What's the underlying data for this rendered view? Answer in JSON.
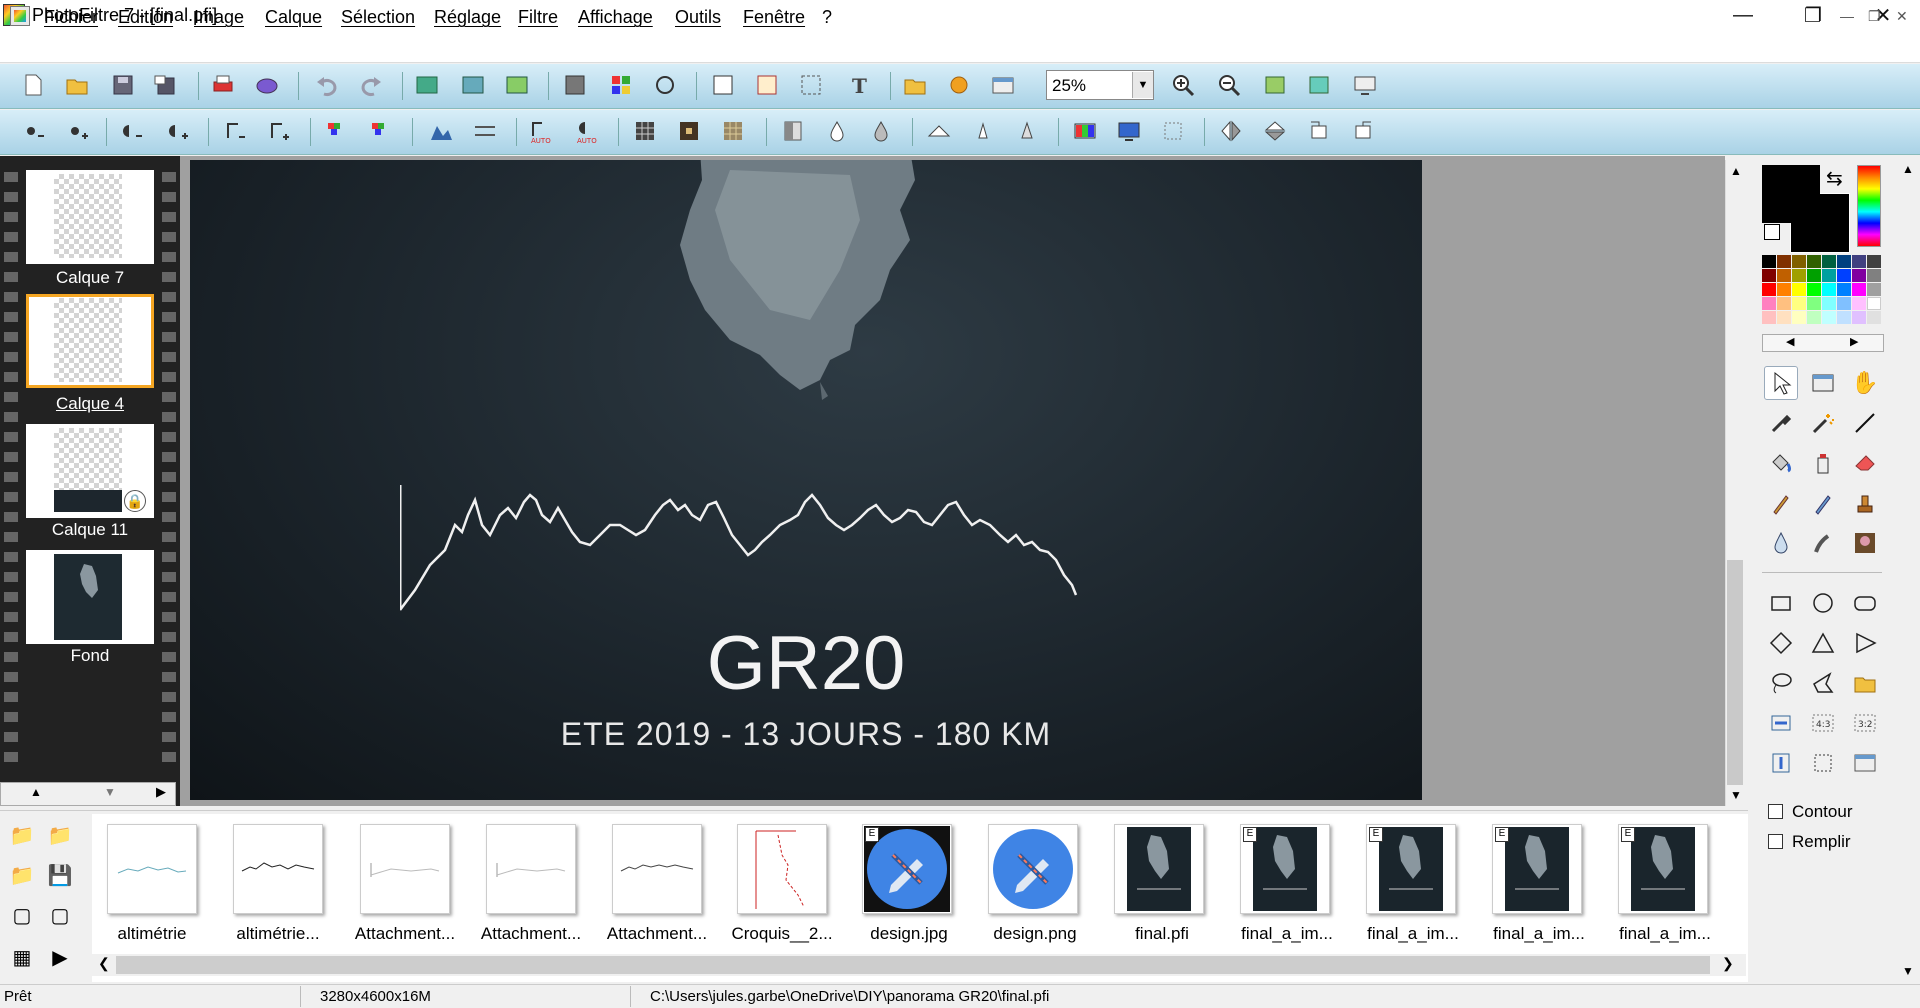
{
  "window": {
    "title": "PhotoFiltre 7 - [final.pfi]"
  },
  "menu": [
    "Fichier",
    "Edition",
    "Image",
    "Calque",
    "Sélection",
    "Réglage",
    "Filtre",
    "Affichage",
    "Outils",
    "Fenêtre",
    "?"
  ],
  "zoom": {
    "value": "25%"
  },
  "layers": [
    {
      "name": "Calque 7"
    },
    {
      "name": "Calque 4",
      "selected": true
    },
    {
      "name": "Calque 11",
      "locked": true
    },
    {
      "name": "Fond"
    }
  ],
  "canvas": {
    "title": "GR20",
    "subtitle": "ETE 2019 - 13 JOURS - 180 KM",
    "background": "#1c252c"
  },
  "options": {
    "contour": "Contour",
    "remplir": "Remplir"
  },
  "files": [
    {
      "label": "altimétrie",
      "kind": "plot-blue"
    },
    {
      "label": "altimétrie...",
      "kind": "plot-black"
    },
    {
      "label": "Attachment...",
      "kind": "plot-faint"
    },
    {
      "label": "Attachment...",
      "kind": "plot-faint"
    },
    {
      "label": "Attachment...",
      "kind": "plot-black"
    },
    {
      "label": "Croquis__2...",
      "kind": "sketch"
    },
    {
      "label": "design.jpg",
      "kind": "design",
      "badge": "E"
    },
    {
      "label": "design.png",
      "kind": "design"
    },
    {
      "label": "final.pfi",
      "kind": "final"
    },
    {
      "label": "final_a_im...",
      "kind": "final",
      "badge": "E"
    },
    {
      "label": "final_a_im...",
      "kind": "final",
      "badge": "E"
    },
    {
      "label": "final_a_im...",
      "kind": "final",
      "badge": "E"
    },
    {
      "label": "final_a_im...",
      "kind": "final",
      "badge": "E"
    }
  ],
  "status": {
    "state": "Prêt",
    "size": "3280x4600x16M",
    "path": "C:\\Users\\jules.garbe\\OneDrive\\DIY\\panorama GR20\\final.pfi"
  },
  "colors": {
    "accent": "#f5a623",
    "toolbar": "#bfe0ef",
    "design_blue": "#3f84e5"
  }
}
